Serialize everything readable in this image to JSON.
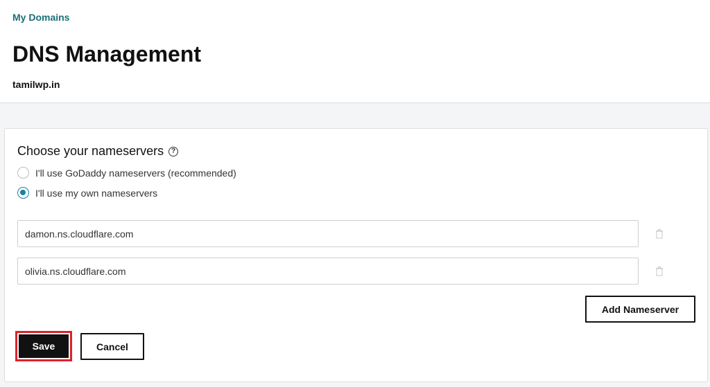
{
  "header": {
    "breadcrumb": "My Domains",
    "title": "DNS Management",
    "domain": "tamilwp.in"
  },
  "nameservers": {
    "section_title": "Choose your nameservers",
    "help_icon_glyph": "?",
    "options": [
      {
        "label": "I'll use GoDaddy nameservers (recommended)",
        "selected": false
      },
      {
        "label": "I'll use my own nameservers",
        "selected": true
      }
    ],
    "entries": [
      {
        "value": "damon.ns.cloudflare.com"
      },
      {
        "value": "olivia.ns.cloudflare.com"
      }
    ],
    "add_label": "Add Nameserver",
    "save_label": "Save",
    "cancel_label": "Cancel"
  },
  "colors": {
    "link": "#1b6f7a",
    "radio_accent": "#1b7fa6",
    "save_highlight": "#e0202a"
  },
  "icons": {
    "help": "help-circle-icon",
    "delete": "trash-icon"
  }
}
